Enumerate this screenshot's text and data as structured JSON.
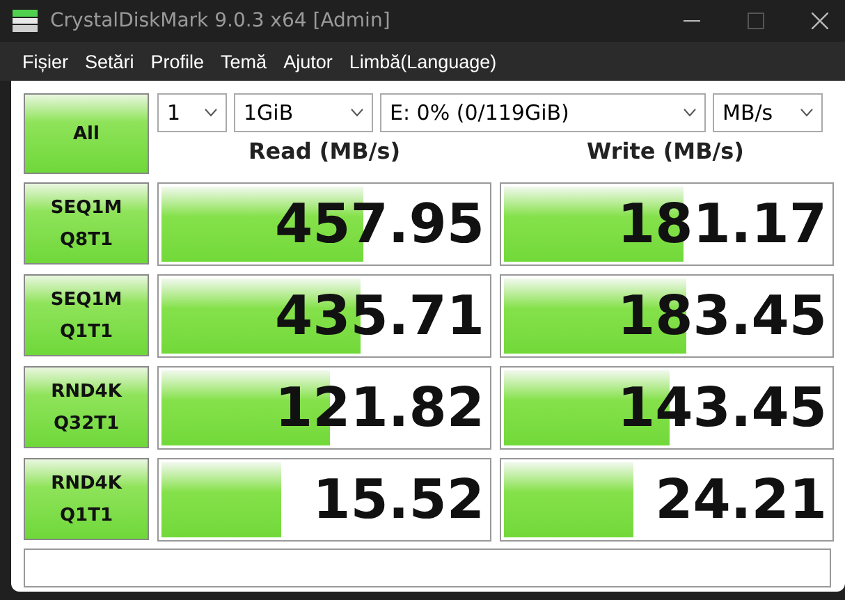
{
  "window": {
    "title": "CrystalDiskMark 9.0.3 x64 [Admin]"
  },
  "menu": [
    "Fișier",
    "Setări",
    "Profile",
    "Temă",
    "Ajutor",
    "Limbă(Language)"
  ],
  "all_button": "All",
  "selectors": [
    {
      "kind": "count",
      "value": "1"
    },
    {
      "kind": "size",
      "value": "1GiB"
    },
    {
      "kind": "drive",
      "value": "E: 0% (0/119GiB)"
    },
    {
      "kind": "unit",
      "value": "MB/s"
    }
  ],
  "columns": [
    "Read (MB/s)",
    "Write (MB/s)"
  ],
  "tests": [
    {
      "line1": "SEQ1M",
      "line2": "Q8T1",
      "read": {
        "value": "457.95",
        "level": 0.61
      },
      "write": {
        "value": "181.17",
        "level": 0.54
      }
    },
    {
      "line1": "SEQ1M",
      "line2": "Q1T1",
      "read": {
        "value": "435.71",
        "level": 0.6
      },
      "write": {
        "value": "183.45",
        "level": 0.55
      }
    },
    {
      "line1": "RND4K",
      "line2": "Q32T1",
      "read": {
        "value": "121.82",
        "level": 0.51
      },
      "write": {
        "value": "143.45",
        "level": 0.5
      }
    },
    {
      "line1": "RND4K",
      "line2": "Q1T1",
      "read": {
        "value": "15.52",
        "level": 0.36
      },
      "write": {
        "value": "24.21",
        "level": 0.39
      }
    }
  ]
}
